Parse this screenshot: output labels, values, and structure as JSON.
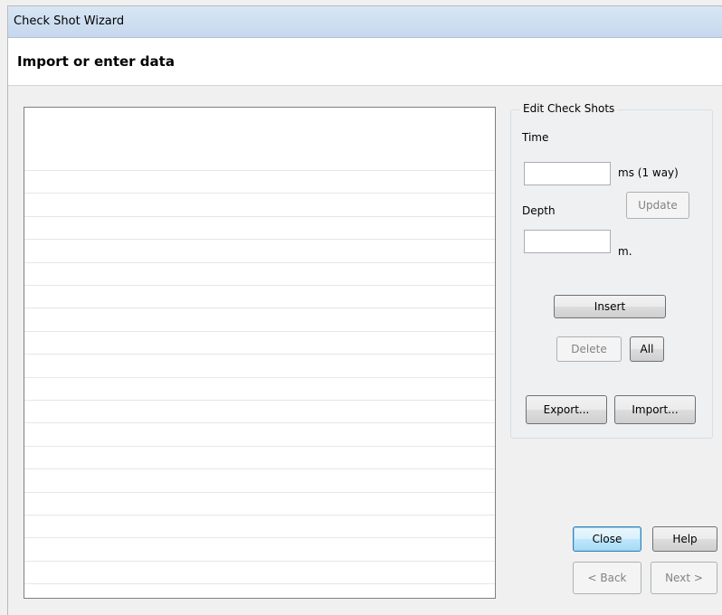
{
  "window": {
    "title": "Check Shot Wizard"
  },
  "header": {
    "title": "Import or enter data"
  },
  "list": {
    "row_count": 21
  },
  "edit_group": {
    "legend": "Edit Check Shots",
    "time_label": "Time",
    "time_value": "",
    "time_unit": "ms (1 way)",
    "depth_label": "Depth",
    "depth_value": "",
    "depth_unit": "m.",
    "update_label": "Update",
    "insert_label": "Insert",
    "delete_label": "Delete",
    "all_label": "All",
    "export_label": "Export...",
    "import_label": "Import..."
  },
  "footer": {
    "close_label": "Close",
    "help_label": "Help",
    "back_label": "< Back",
    "next_label": "Next >"
  }
}
